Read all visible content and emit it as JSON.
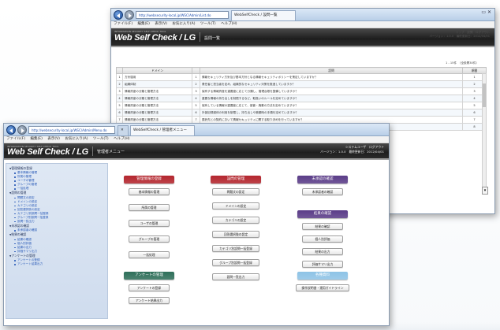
{
  "back_window": {
    "address": "http://websecurity-local.jp/WSC/Admin/List.do",
    "tab_active": "WebSelfCheck / 設問一覧",
    "menu": [
      "ファイル(F)",
      "編集(E)",
      "表示(V)",
      "お気に入り(A)",
      "ツール(T)",
      "ヘルプ(H)"
    ],
    "logo_sub": "INFORMATION SECURITY SELF-CHECK TOOL",
    "logo": "Web Self Check / LG",
    "header_title": "設問一覧",
    "info_line1": "トップ　設問　ログアウト",
    "info_line2": "バージョン：1.0.0　最終更新日：2012/04/01",
    "count_text": "1 - 15件　（全設問30件）",
    "table": {
      "headers": [
        "",
        "ドメイン",
        "",
        "設問",
        "順番"
      ],
      "rows": [
        [
          "1",
          "方針運用",
          "1",
          "情報セキュリティ方針及び基本方針となる情報セキュリティポリシーを策定していますか？",
          "1"
        ],
        [
          "2",
          "組織体制",
          "2",
          "責任者と担当者を定め、組織的なセキュリティ対策を推進していますか？",
          "2"
        ],
        [
          "3",
          "情報資産の分類と管理方法",
          "3",
          "保有する情報資産を重要度に応じて分類し、管理台帳を整備していますか？",
          "3"
        ],
        [
          "4",
          "情報資産の分類と管理方法",
          "4",
          "重要な情報の持ち出しを制限するなど、取扱いのルールを定めていますか？",
          "4"
        ],
        [
          "5",
          "情報資産の分類と管理方法",
          "5",
          "保有している情報の重要度に応じて、保管・廃棄の方法を定めていますか？",
          "5"
        ],
        [
          "6",
          "情報資産の分類と管理方法",
          "6",
          "外部記録媒体の利用を制限し、持ち出しや廃棄時の手順を定めていますか？",
          "6"
        ],
        [
          "7",
          "情報資産の分類と管理方法",
          "7",
          "委託先との契約において情報セキュリティに関する取り決めを行っていますか？",
          "7"
        ],
        [
          "8",
          "物理的セキュリティ",
          "8",
          "サーバ室などの重要エリアへの入退室管理を実施していますか？",
          "8"
        ]
      ]
    }
  },
  "front_window": {
    "address": "http://websecurity-local.jp/WSC/Admin/Menu.do",
    "tab_active": "WebSelfCheck / 管理者メニュー",
    "menu": [
      "ファイル(F)",
      "編集(E)",
      "表示(V)",
      "お気に入り(A)",
      "ツール(T)",
      "ヘルプ(H)"
    ],
    "logo_sub": "INFORMATION SECURITY SELF-CHECK TOOL",
    "logo": "Web Self Check / LG",
    "header_title": "管理者メニュー",
    "info_line1": "システムユーザ　ログアウト",
    "info_line2": "バージョン：1.0.0　最終更新日：2012/04/01",
    "sidebar": [
      {
        "title": "管理情報の登録",
        "items": [
          "基本情報の管理",
          "所属の管理",
          "ユーザの管理",
          "グループの管理",
          "一括処理"
        ]
      },
      {
        "title": "設問の管理",
        "items": [
          "問題文の設定",
          "ドメインの設定",
          "カテゴリの設定",
          "回答選択肢の設定",
          "カテゴリ別設問一括登録",
          "グループ別設問一括登録",
          "設問一覧出力"
        ]
      },
      {
        "title": "未承認の確認",
        "items": [
          "未承認者の確認"
        ]
      },
      {
        "title": "結果の確認",
        "items": [
          "結果の確認",
          "個人別評価",
          "結果の出力",
          "評価サマリ出力"
        ]
      },
      {
        "title": "アンケートの管理",
        "items": [
          "アンケートの登録",
          "アンケート結果出力"
        ]
      }
    ],
    "groups": {
      "kanri": {
        "title": "管理情報の登録",
        "buttons": [
          "基本情報の管理",
          "所属の管理",
          "ユーザの管理",
          "グループの管理",
          "一括処理"
        ]
      },
      "setsumon": {
        "title": "設問の管理",
        "buttons": [
          "問題文の設定",
          "ドメインの設定",
          "カテゴリの設定",
          "回答選択肢の設定",
          "カテゴリ別設問一括登録",
          "グループ別設問一括登録",
          "設問一覧出力"
        ]
      },
      "mishonin": {
        "title": "未承認の確認",
        "buttons": [
          "未承認者の確認"
        ]
      },
      "kekka": {
        "title": "結果の確認",
        "buttons": [
          "結果の確認",
          "個人別評価",
          "結果の出力",
          "評価サマリ出力"
        ]
      },
      "enquete": {
        "title": "アンケートの管理",
        "buttons": [
          "アンケートの登録",
          "アンケート結果出力"
        ]
      },
      "help": {
        "title": "各種資料",
        "buttons": [
          "操作説明書・運用ガイドライン"
        ]
      }
    },
    "colors": {
      "red": "#b3262e",
      "purple": "#5b3d88",
      "green": "#2f6f5a",
      "lightblue": "#8ec3e6"
    }
  }
}
